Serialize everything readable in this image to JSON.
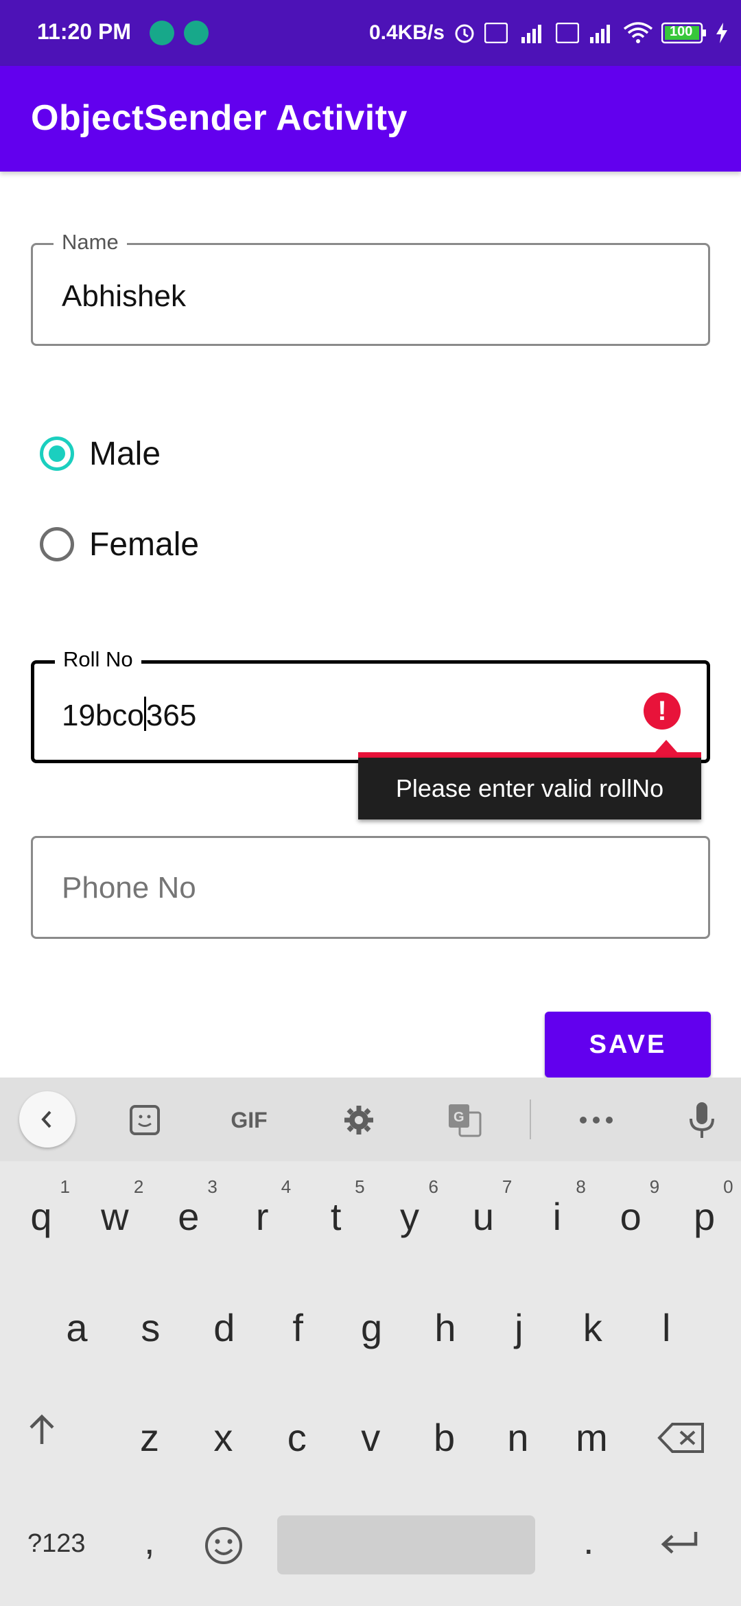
{
  "status_bar": {
    "time": "11:20 PM",
    "net_speed": "0.4KB/s",
    "battery": "100"
  },
  "app_bar": {
    "title": "ObjectSender Activity"
  },
  "form": {
    "name": {
      "label": "Name",
      "value": "Abhishek"
    },
    "gender": [
      {
        "label": "Male",
        "checked": true
      },
      {
        "label": "Female",
        "checked": false
      }
    ],
    "roll_no": {
      "label": "Roll No",
      "value_before_cursor": "19bco",
      "value_after_cursor": "365",
      "error": "Please enter valid rollNo"
    },
    "phone": {
      "placeholder": "Phone No",
      "value": ""
    },
    "save_label": "SAVE"
  },
  "keyboard": {
    "toolbar_gif": "GIF",
    "row1": [
      {
        "letter": "q",
        "hint": "1"
      },
      {
        "letter": "w",
        "hint": "2"
      },
      {
        "letter": "e",
        "hint": "3"
      },
      {
        "letter": "r",
        "hint": "4"
      },
      {
        "letter": "t",
        "hint": "5"
      },
      {
        "letter": "y",
        "hint": "6"
      },
      {
        "letter": "u",
        "hint": "7"
      },
      {
        "letter": "i",
        "hint": "8"
      },
      {
        "letter": "o",
        "hint": "9"
      },
      {
        "letter": "p",
        "hint": "0"
      }
    ],
    "row2": [
      "a",
      "s",
      "d",
      "f",
      "g",
      "h",
      "j",
      "k",
      "l"
    ],
    "row3": [
      "z",
      "x",
      "c",
      "v",
      "b",
      "n",
      "m"
    ],
    "symbols_label": "?123",
    "comma": ",",
    "period": "."
  },
  "colors": {
    "status_bar": "#4d12b7",
    "primary": "#6200ee",
    "radio_accent": "#1bcfbf",
    "error": "#e8133a"
  }
}
